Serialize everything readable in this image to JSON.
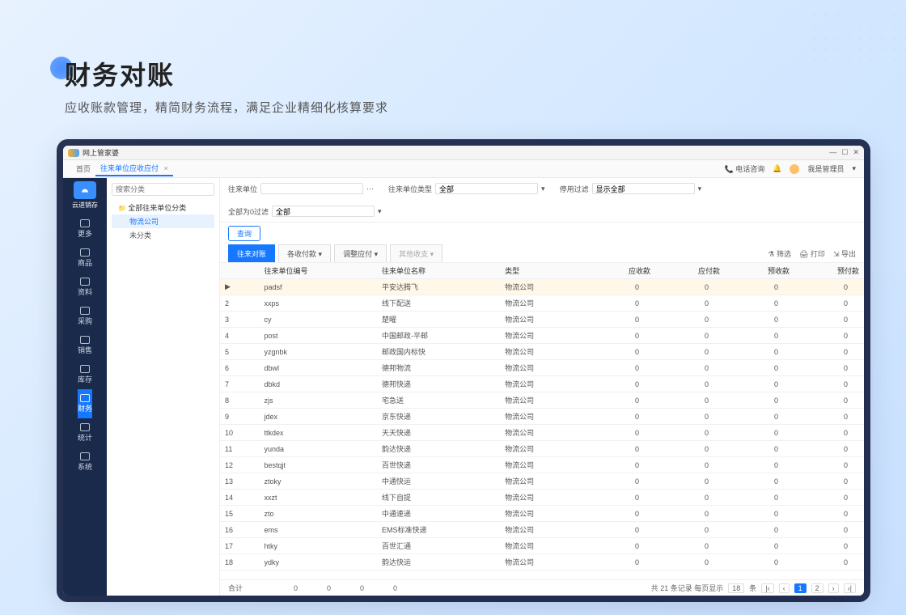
{
  "hero": {
    "title": "财务对账",
    "subtitle": "应收账款管理，精简财务流程，满足企业精细化核算要求"
  },
  "window": {
    "title": "网上管家婆",
    "tabs": {
      "home": "首页",
      "active": "往来单位应收应付"
    },
    "topRight": {
      "consult": "电话咨询",
      "user": "我是管理员"
    }
  },
  "sidebar": {
    "brand": "云进销存",
    "items": [
      {
        "label": "更多"
      },
      {
        "label": "商品"
      },
      {
        "label": "资料"
      },
      {
        "label": "采购"
      },
      {
        "label": "销售"
      },
      {
        "label": "库存"
      },
      {
        "label": "财务"
      },
      {
        "label": "统计"
      },
      {
        "label": "系统"
      }
    ],
    "activeIndex": 6
  },
  "tree": {
    "searchPlaceholder": "搜索分类",
    "root": "全部往来单位分类",
    "children": [
      "物流公司",
      "未分类"
    ]
  },
  "filters": {
    "f1": {
      "label": "往来单位",
      "value": ""
    },
    "f2": {
      "label": "往来单位类型",
      "value": "全部"
    },
    "f3": {
      "label": "停用过滤",
      "value": "显示全部"
    },
    "f4": {
      "label": "全部为0过滤",
      "value": "全部"
    },
    "queryBtn": "查询"
  },
  "subtabs": [
    "往来对账",
    "各收付款",
    "调整应付",
    "其他收支"
  ],
  "toolbar": {
    "filter": "筛选",
    "print": "打印",
    "export": "导出"
  },
  "columns": [
    "",
    "往来单位编号",
    "往来单位名称",
    "类型",
    "应收款",
    "应付款",
    "预收款",
    "预付款"
  ],
  "rows": [
    {
      "n": "▶",
      "code": "padsf",
      "name": "平安达腾飞",
      "type": "物流公司",
      "v": [
        0,
        0,
        0,
        0
      ],
      "hl": true
    },
    {
      "n": "2",
      "code": "xxps",
      "name": "线下配送",
      "type": "物流公司",
      "v": [
        0,
        0,
        0,
        0
      ]
    },
    {
      "n": "3",
      "code": "cy",
      "name": "楚曜",
      "type": "物流公司",
      "v": [
        0,
        0,
        0,
        0
      ]
    },
    {
      "n": "4",
      "code": "post",
      "name": "中国邮政-平邮",
      "type": "物流公司",
      "v": [
        0,
        0,
        0,
        0
      ]
    },
    {
      "n": "5",
      "code": "yzgnbk",
      "name": "邮政国内标快",
      "type": "物流公司",
      "v": [
        0,
        0,
        0,
        0
      ]
    },
    {
      "n": "6",
      "code": "dbwl",
      "name": "德邦物流",
      "type": "物流公司",
      "v": [
        0,
        0,
        0,
        0
      ]
    },
    {
      "n": "7",
      "code": "dbkd",
      "name": "德邦快递",
      "type": "物流公司",
      "v": [
        0,
        0,
        0,
        0
      ]
    },
    {
      "n": "8",
      "code": "zjs",
      "name": "宅急送",
      "type": "物流公司",
      "v": [
        0,
        0,
        0,
        0
      ]
    },
    {
      "n": "9",
      "code": "jdex",
      "name": "京东快递",
      "type": "物流公司",
      "v": [
        0,
        0,
        0,
        0
      ]
    },
    {
      "n": "10",
      "code": "ttkdex",
      "name": "天天快递",
      "type": "物流公司",
      "v": [
        0,
        0,
        0,
        0
      ]
    },
    {
      "n": "11",
      "code": "yunda",
      "name": "韵达快递",
      "type": "物流公司",
      "v": [
        0,
        0,
        0,
        0
      ]
    },
    {
      "n": "12",
      "code": "bestqjt",
      "name": "百世快递",
      "type": "物流公司",
      "v": [
        0,
        0,
        0,
        0
      ]
    },
    {
      "n": "13",
      "code": "ztoky",
      "name": "中通快运",
      "type": "物流公司",
      "v": [
        0,
        0,
        0,
        0
      ]
    },
    {
      "n": "14",
      "code": "xxzt",
      "name": "线下自提",
      "type": "物流公司",
      "v": [
        0,
        0,
        0,
        0
      ]
    },
    {
      "n": "15",
      "code": "zto",
      "name": "中通速递",
      "type": "物流公司",
      "v": [
        0,
        0,
        0,
        0
      ]
    },
    {
      "n": "16",
      "code": "ems",
      "name": "EMS标准快递",
      "type": "物流公司",
      "v": [
        0,
        0,
        0,
        0
      ]
    },
    {
      "n": "17",
      "code": "htky",
      "name": "百世汇通",
      "type": "物流公司",
      "v": [
        0,
        0,
        0,
        0
      ]
    },
    {
      "n": "18",
      "code": "ydky",
      "name": "韵达快运",
      "type": "物流公司",
      "v": [
        0,
        0,
        0,
        0
      ]
    }
  ],
  "sumRow": {
    "label": "合计",
    "v": [
      0,
      0,
      0,
      0
    ]
  },
  "pager": {
    "text": "共 21 条记录 每页显示",
    "size": "18",
    "pageLabel": "条",
    "pages": [
      "1",
      "2"
    ],
    "cur": 1
  }
}
